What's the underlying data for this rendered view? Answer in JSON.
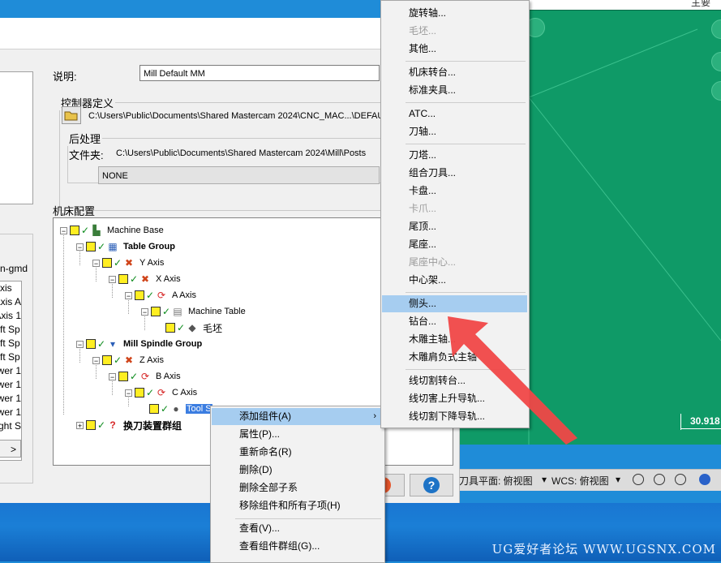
{
  "viewport": {
    "top_text": "主要",
    "dim_value": "30.918"
  },
  "statusbar": {
    "tool_plane": "刀具平面: 俯视图",
    "wcs": "WCS: 俯视图"
  },
  "left": {
    "suffix": "n-gmd",
    "list": [
      "xis",
      "Axis A",
      "Axis 1",
      "ft Sp",
      "ft Sp",
      "ft Sp",
      "wer 1",
      "wer 1",
      "wer 1",
      "wer 1",
      "ght S"
    ],
    "scroll": ">"
  },
  "dialog": {
    "desc_label": "说明:",
    "desc_value": "Mill Default MM",
    "ctrl_group_label": "控制器定义",
    "ctrl_path": "C:\\Users\\Public\\Documents\\Shared Mastercam 2024\\CNC_MAC...\\DEFAULT",
    "post_group_label": "后处理",
    "post_folder_label": "文件夹:",
    "post_path": "C:\\Users\\Public\\Documents\\Shared Mastercam 2024\\Mill\\Posts",
    "post_select": "NONE",
    "tree_label": "机床配置"
  },
  "tree": {
    "machine_base": "Machine Base",
    "table_group": "Table Group",
    "y_axis": "Y Axis",
    "x_axis": "X Axis",
    "a_axis": "A Axis",
    "machine_table": "Machine Table",
    "stock": "毛坯",
    "spindle_group": "Mill Spindle Group",
    "z_axis": "Z Axis",
    "b_axis": "B Axis",
    "c_axis": "C Axis",
    "tool_spindle": "Tool S",
    "tool_changer": "换刀装置群组"
  },
  "context_menu": {
    "add": "添加组件(A)",
    "props": "属性(P)...",
    "rename": "重新命名(R)",
    "delete": "删除(D)",
    "delete_children": "删除全部子系",
    "remove_with_children": "移除组件和所有子项(H)",
    "view": "查看(V)...",
    "view_group": "查看组件群组(G)..."
  },
  "submenu": {
    "rotary_axis": "旋转轴...",
    "stock": "毛坯...",
    "other": "其他...",
    "machine_rotary": "机床转台...",
    "std_fixture": "标准夹具...",
    "atc": "ATC...",
    "tool_axis": "刀轴...",
    "turret": "刀塔...",
    "gang_tool": "组合刀具...",
    "chuck": "卡盘...",
    "jaw": "卡爪...",
    "tailstock": "尾顶...",
    "tail_base": "尾座...",
    "tail_center": "尾座中心...",
    "steady_rest": "中心架...",
    "side_head": "侧头...",
    "drill_table": "钻台...",
    "router_spindle": "木雕主轴...",
    "router_shoulder": "木雕肩负式主轴",
    "wire_rotary": "线切割转台...",
    "wire_upper": "线切害上升导轨...",
    "wire_lower": "线切割下降导轨..."
  },
  "watermark": "UG爱好者论坛 WWW.UGSNX.COM",
  "colors": {
    "viewport": "#0f9a67",
    "highlight": "#a6cdf0",
    "arrow": "#f04747"
  }
}
